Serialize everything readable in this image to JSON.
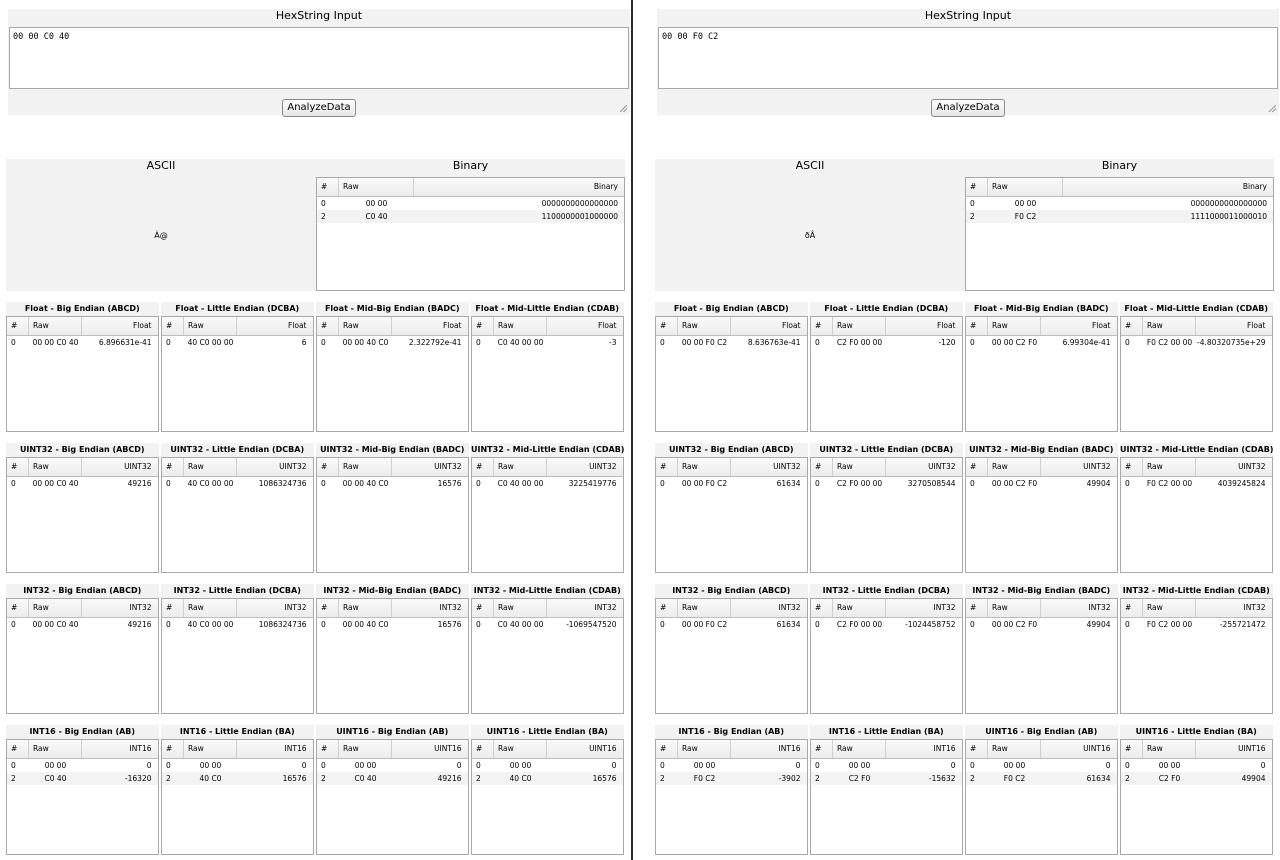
{
  "hex_title": "HexString Input",
  "analyze_label": "AnalyzeData",
  "ascii_title": "ASCII",
  "binary_title": "Binary",
  "col_index": "#",
  "col_raw": "Raw",
  "col_binary": "Binary",
  "panels": [
    {
      "hex_value": "00 00 C0 40",
      "ascii_value": "À@",
      "binary_rows": [
        {
          "idx": "0",
          "raw": "00 00",
          "value": "0000000000000000"
        },
        {
          "idx": "2",
          "raw": "C0 40",
          "value": "1100000001000000"
        }
      ],
      "rows": [
        [
          {
            "title": "Float - Big Endian (ABCD)",
            "type": "Float",
            "rows": [
              {
                "idx": "0",
                "raw": "00 00 C0 40",
                "value": "6.896631e-41"
              }
            ]
          },
          {
            "title": "Float - Little Endian (DCBA)",
            "type": "Float",
            "rows": [
              {
                "idx": "0",
                "raw": "40 C0 00 00",
                "value": "6"
              }
            ]
          },
          {
            "title": "Float - Mid-Big Endian (BADC)",
            "type": "Float",
            "rows": [
              {
                "idx": "0",
                "raw": "00 00 40 C0",
                "value": "2.322792e-41"
              }
            ]
          },
          {
            "title": "Float - Mid-Little Endian (CDAB)",
            "type": "Float",
            "rows": [
              {
                "idx": "0",
                "raw": "C0 40 00 00",
                "value": "-3"
              }
            ]
          }
        ],
        [
          {
            "title": "UINT32 - Big Endian (ABCD)",
            "type": "UINT32",
            "rows": [
              {
                "idx": "0",
                "raw": "00 00 C0 40",
                "value": "49216"
              }
            ]
          },
          {
            "title": "UINT32 - Little Endian (DCBA)",
            "type": "UINT32",
            "rows": [
              {
                "idx": "0",
                "raw": "40 C0 00 00",
                "value": "1086324736"
              }
            ]
          },
          {
            "title": "UINT32 - Mid-Big Endian (BADC)",
            "type": "UINT32",
            "rows": [
              {
                "idx": "0",
                "raw": "00 00 40 C0",
                "value": "16576"
              }
            ]
          },
          {
            "title": "UINT32 - Mid-Little Endian (CDAB)",
            "type": "UINT32",
            "rows": [
              {
                "idx": "0",
                "raw": "C0 40 00 00",
                "value": "3225419776"
              }
            ]
          }
        ],
        [
          {
            "title": "INT32 - Big Endian (ABCD)",
            "type": "INT32",
            "rows": [
              {
                "idx": "0",
                "raw": "00 00 C0 40",
                "value": "49216"
              }
            ]
          },
          {
            "title": "INT32 - Little Endian (DCBA)",
            "type": "INT32",
            "rows": [
              {
                "idx": "0",
                "raw": "40 C0 00 00",
                "value": "1086324736"
              }
            ]
          },
          {
            "title": "INT32 - Mid-Big Endian (BADC)",
            "type": "INT32",
            "rows": [
              {
                "idx": "0",
                "raw": "00 00 40 C0",
                "value": "16576"
              }
            ]
          },
          {
            "title": "INT32 - Mid-Little Endian (CDAB)",
            "type": "INT32",
            "rows": [
              {
                "idx": "0",
                "raw": "C0 40 00 00",
                "value": "-1069547520"
              }
            ]
          }
        ],
        [
          {
            "title": "INT16 - Big Endian (AB)",
            "type": "INT16",
            "rows": [
              {
                "idx": "0",
                "raw": "00 00",
                "value": "0"
              },
              {
                "idx": "2",
                "raw": "C0 40",
                "value": "-16320"
              }
            ]
          },
          {
            "title": "INT16 - Little Endian (BA)",
            "type": "INT16",
            "rows": [
              {
                "idx": "0",
                "raw": "00 00",
                "value": "0"
              },
              {
                "idx": "2",
                "raw": "40 C0",
                "value": "16576"
              }
            ]
          },
          {
            "title": "UINT16 - Big Endian (AB)",
            "type": "UINT16",
            "rows": [
              {
                "idx": "0",
                "raw": "00 00",
                "value": "0"
              },
              {
                "idx": "2",
                "raw": "C0 40",
                "value": "49216"
              }
            ]
          },
          {
            "title": "UINT16 - Little Endian (BA)",
            "type": "UINT16",
            "rows": [
              {
                "idx": "0",
                "raw": "00 00",
                "value": "0"
              },
              {
                "idx": "2",
                "raw": "40 C0",
                "value": "16576"
              }
            ]
          }
        ]
      ]
    },
    {
      "hex_value": "00 00 F0 C2",
      "ascii_value": "ðÂ",
      "binary_rows": [
        {
          "idx": "0",
          "raw": "00 00",
          "value": "0000000000000000"
        },
        {
          "idx": "2",
          "raw": "F0 C2",
          "value": "1111000011000010"
        }
      ],
      "rows": [
        [
          {
            "title": "Float - Big Endian (ABCD)",
            "type": "Float",
            "rows": [
              {
                "idx": "0",
                "raw": "00 00 F0 C2",
                "value": "8.636763e-41"
              }
            ]
          },
          {
            "title": "Float - Little Endian (DCBA)",
            "type": "Float",
            "rows": [
              {
                "idx": "0",
                "raw": "C2 F0 00 00",
                "value": "-120"
              }
            ]
          },
          {
            "title": "Float - Mid-Big Endian (BADC)",
            "type": "Float",
            "rows": [
              {
                "idx": "0",
                "raw": "00 00 C2 F0",
                "value": "6.99304e-41"
              }
            ]
          },
          {
            "title": "Float - Mid-Little Endian (CDAB)",
            "type": "Float",
            "rows": [
              {
                "idx": "0",
                "raw": "F0 C2 00 00",
                "value": "-4.80320735e+29"
              }
            ]
          }
        ],
        [
          {
            "title": "UINT32 - Big Endian (ABCD)",
            "type": "UINT32",
            "rows": [
              {
                "idx": "0",
                "raw": "00 00 F0 C2",
                "value": "61634"
              }
            ]
          },
          {
            "title": "UINT32 - Little Endian (DCBA)",
            "type": "UINT32",
            "rows": [
              {
                "idx": "0",
                "raw": "C2 F0 00 00",
                "value": "3270508544"
              }
            ]
          },
          {
            "title": "UINT32 - Mid-Big Endian (BADC)",
            "type": "UINT32",
            "rows": [
              {
                "idx": "0",
                "raw": "00 00 C2 F0",
                "value": "49904"
              }
            ]
          },
          {
            "title": "UINT32 - Mid-Little Endian (CDAB)",
            "type": "UINT32",
            "rows": [
              {
                "idx": "0",
                "raw": "F0 C2 00 00",
                "value": "4039245824"
              }
            ]
          }
        ],
        [
          {
            "title": "INT32 - Big Endian (ABCD)",
            "type": "INT32",
            "rows": [
              {
                "idx": "0",
                "raw": "00 00 F0 C2",
                "value": "61634"
              }
            ]
          },
          {
            "title": "INT32 - Little Endian (DCBA)",
            "type": "INT32",
            "rows": [
              {
                "idx": "0",
                "raw": "C2 F0 00 00",
                "value": "-1024458752"
              }
            ]
          },
          {
            "title": "INT32 - Mid-Big Endian (BADC)",
            "type": "INT32",
            "rows": [
              {
                "idx": "0",
                "raw": "00 00 C2 F0",
                "value": "49904"
              }
            ]
          },
          {
            "title": "INT32 - Mid-Little Endian (CDAB)",
            "type": "INT32",
            "rows": [
              {
                "idx": "0",
                "raw": "F0 C2 00 00",
                "value": "-255721472"
              }
            ]
          }
        ],
        [
          {
            "title": "INT16 - Big Endian (AB)",
            "type": "INT16",
            "rows": [
              {
                "idx": "0",
                "raw": "00 00",
                "value": "0"
              },
              {
                "idx": "2",
                "raw": "F0 C2",
                "value": "-3902"
              }
            ]
          },
          {
            "title": "INT16 - Little Endian (BA)",
            "type": "INT16",
            "rows": [
              {
                "idx": "0",
                "raw": "00 00",
                "value": "0"
              },
              {
                "idx": "2",
                "raw": "C2 F0",
                "value": "-15632"
              }
            ]
          },
          {
            "title": "UINT16 - Big Endian (AB)",
            "type": "UINT16",
            "rows": [
              {
                "idx": "0",
                "raw": "00 00",
                "value": "0"
              },
              {
                "idx": "2",
                "raw": "F0 C2",
                "value": "61634"
              }
            ]
          },
          {
            "title": "UINT16 - Little Endian (BA)",
            "type": "UINT16",
            "rows": [
              {
                "idx": "0",
                "raw": "00 00",
                "value": "0"
              },
              {
                "idx": "2",
                "raw": "C2 F0",
                "value": "49904"
              }
            ]
          }
        ]
      ]
    }
  ]
}
